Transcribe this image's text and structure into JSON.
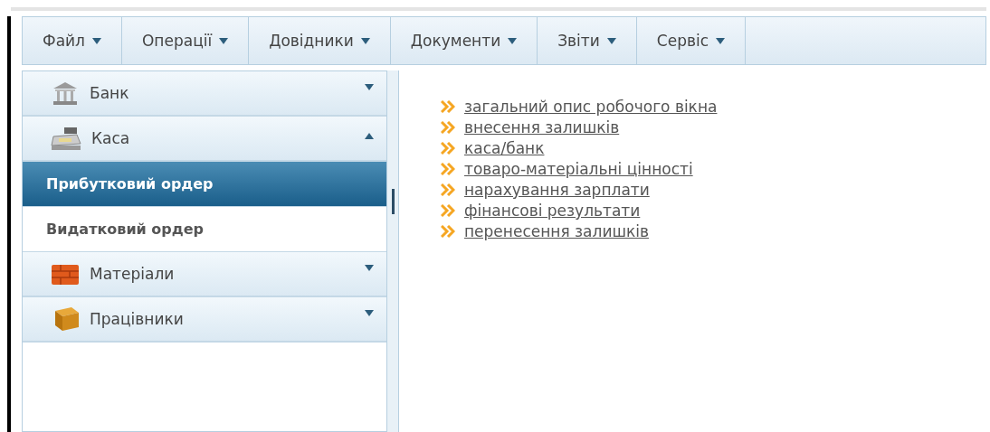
{
  "menu": [
    {
      "label": "Файл"
    },
    {
      "label": "Операції"
    },
    {
      "label": "Довідники"
    },
    {
      "label": "Документи"
    },
    {
      "label": "Звіти"
    },
    {
      "label": "Сервіс"
    }
  ],
  "sidebar": {
    "groups": [
      {
        "label": "Банк",
        "kind": "bank",
        "expanded": false
      },
      {
        "label": "Каса",
        "kind": "cash",
        "expanded": true,
        "children": [
          {
            "label": "Прибутковий ордер",
            "selected": true
          },
          {
            "label": "Видатковий ордер",
            "selected": false
          }
        ]
      },
      {
        "label": "Матеріали",
        "kind": "materials",
        "expanded": false
      },
      {
        "label": "Працівники",
        "kind": "staff",
        "expanded": false
      }
    ]
  },
  "links": [
    "загальний опис робочого вікна",
    "внесення залишків",
    "каса/банк",
    "товаро-матеріальні цінності",
    "нарахування зарплати",
    "фінансові результати",
    "перенесення залишків"
  ]
}
